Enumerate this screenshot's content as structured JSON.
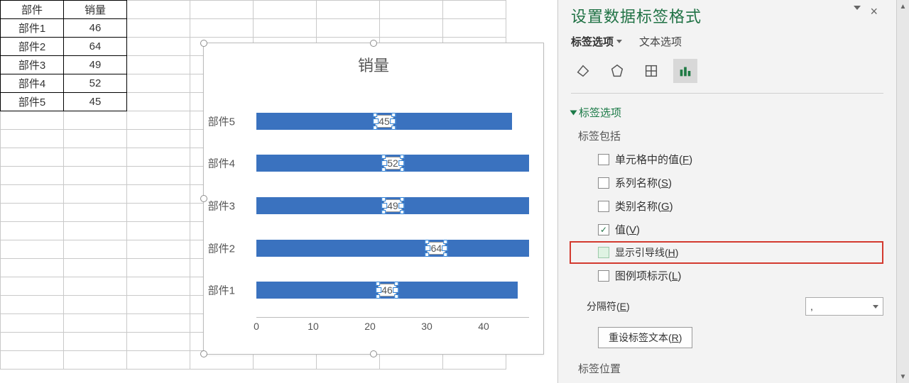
{
  "table": {
    "headers": [
      "部件",
      "销量"
    ],
    "rows": [
      [
        "部件1",
        "46"
      ],
      [
        "部件2",
        "64"
      ],
      [
        "部件3",
        "49"
      ],
      [
        "部件4",
        "52"
      ],
      [
        "部件5",
        "45"
      ]
    ]
  },
  "chart_data": {
    "type": "bar",
    "orientation": "horizontal",
    "title": "销量",
    "categories": [
      "部件1",
      "部件2",
      "部件3",
      "部件4",
      "部件5"
    ],
    "display_order_top_to_bottom": [
      "部件5",
      "部件4",
      "部件3",
      "部件2",
      "部件1"
    ],
    "values": [
      46,
      64,
      49,
      52,
      45
    ],
    "xlabel": "",
    "ylabel": "",
    "xlim": [
      0,
      50
    ],
    "xticks": [
      0,
      10,
      20,
      30,
      40
    ],
    "series_color": "#3a72bf",
    "data_labels_visible": true
  },
  "pane": {
    "title": "设置数据标签格式",
    "tabs": {
      "options": "标签选项",
      "text": "文本选项"
    },
    "icons": {
      "fill": "fill-icon",
      "effects": "effects-icon",
      "size": "size-icon",
      "chart": "chart-icon"
    },
    "section_label_options": "标签选项",
    "label_includes_hdr": "标签包括",
    "options": {
      "cell_value": "单元格中的值(F)",
      "series_name": "系列名称(S)",
      "category_name": "类别名称(G)",
      "value": "值(V)",
      "leader_lines": "显示引导线(H)",
      "legend_key": "图例项标示(L)"
    },
    "separator_label": "分隔符(E)",
    "separator_value": ",",
    "reset_button": "重设标签文本(R)",
    "position_hdr": "标签位置"
  },
  "ui": {
    "close": "×"
  }
}
